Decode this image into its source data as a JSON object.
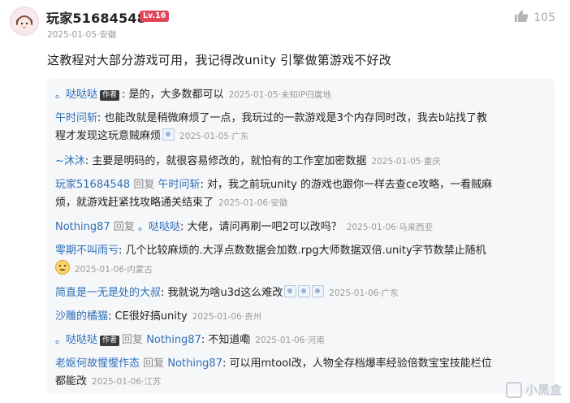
{
  "post": {
    "username": "玩家51684548",
    "level": "Lv.16",
    "likes": "105",
    "date": "2025-01-05",
    "location": "安徽",
    "text": "这教程对大部分游戏可用，我记得改unity 引擎做第游戏不好改"
  },
  "labels": {
    "author_tag": "作者",
    "reply_word": "回复",
    "dot": "·"
  },
  "replies": [
    {
      "user": "。哒哒哒",
      "author": true,
      "text": ": 是的，大多数都可以",
      "date": "2025-01-05",
      "loc": "未知IP归属地"
    },
    {
      "user": "午时问斩",
      "text": ": 也能改就是稍微麻烦了一点，我玩过的一款游戏是3个内存同时改，我去b站找了教",
      "text2": "程才发现这玩意贼麻烦",
      "date": "2025-01-05",
      "loc": "广东"
    },
    {
      "user": "~沐沐",
      "text": ": 主要是明码的，就很容易修改的，就怕有的工作室加密数据",
      "date": "2025-01-05",
      "loc": "重庆"
    },
    {
      "user": "玩家51684548",
      "target": "午时问斩",
      "text": ": 对，我之前玩unity 的游戏也跟你一样去查ce攻略，一看贼麻",
      "text2": "烦，就游戏赶紧找攻略通关结束了",
      "date": "2025-01-06",
      "loc": "安徽"
    },
    {
      "user": "Nothing87",
      "target": "。哒哒哒",
      "text": ": 大佬，请问再刷一吧2可以改吗？",
      "date": "2025-01-06",
      "loc": "马来西亚"
    },
    {
      "user": "零期不叫雨亏",
      "text": ": 几个比较麻烦的.大浮点数数据会加数.rpg大师数据双倍.unity字节数禁止随机",
      "date": "2025-01-06",
      "loc": "内蒙古"
    },
    {
      "user": "简直是一无是处的大叔",
      "text": ": 我就说为啥u3d这么难改",
      "date": "2025-01-06",
      "loc": "广东"
    },
    {
      "user": "沙雕的橘猫",
      "text": ": CE很好搞unity",
      "date": "2025-01-06",
      "loc": "贵州"
    },
    {
      "user": "。哒哒哒",
      "author": true,
      "target": "Nothing87",
      "text": ": 不知道嘞",
      "date": "2025-01-06",
      "loc": "河南"
    },
    {
      "user": "老妪何故惺惺作态",
      "target": "Nothing87",
      "text": ": 可以用mtool改，人物全存档爆率经验倍数宝宝技能栏位",
      "text2": "都能改",
      "date": "2025-01-06",
      "loc": "江苏"
    }
  ],
  "watermark": "小黑盒",
  "colors": {
    "name_blue": "#2e6fb8",
    "level_badge": "#e0465a",
    "reply_bg": "#f6f7f9"
  }
}
